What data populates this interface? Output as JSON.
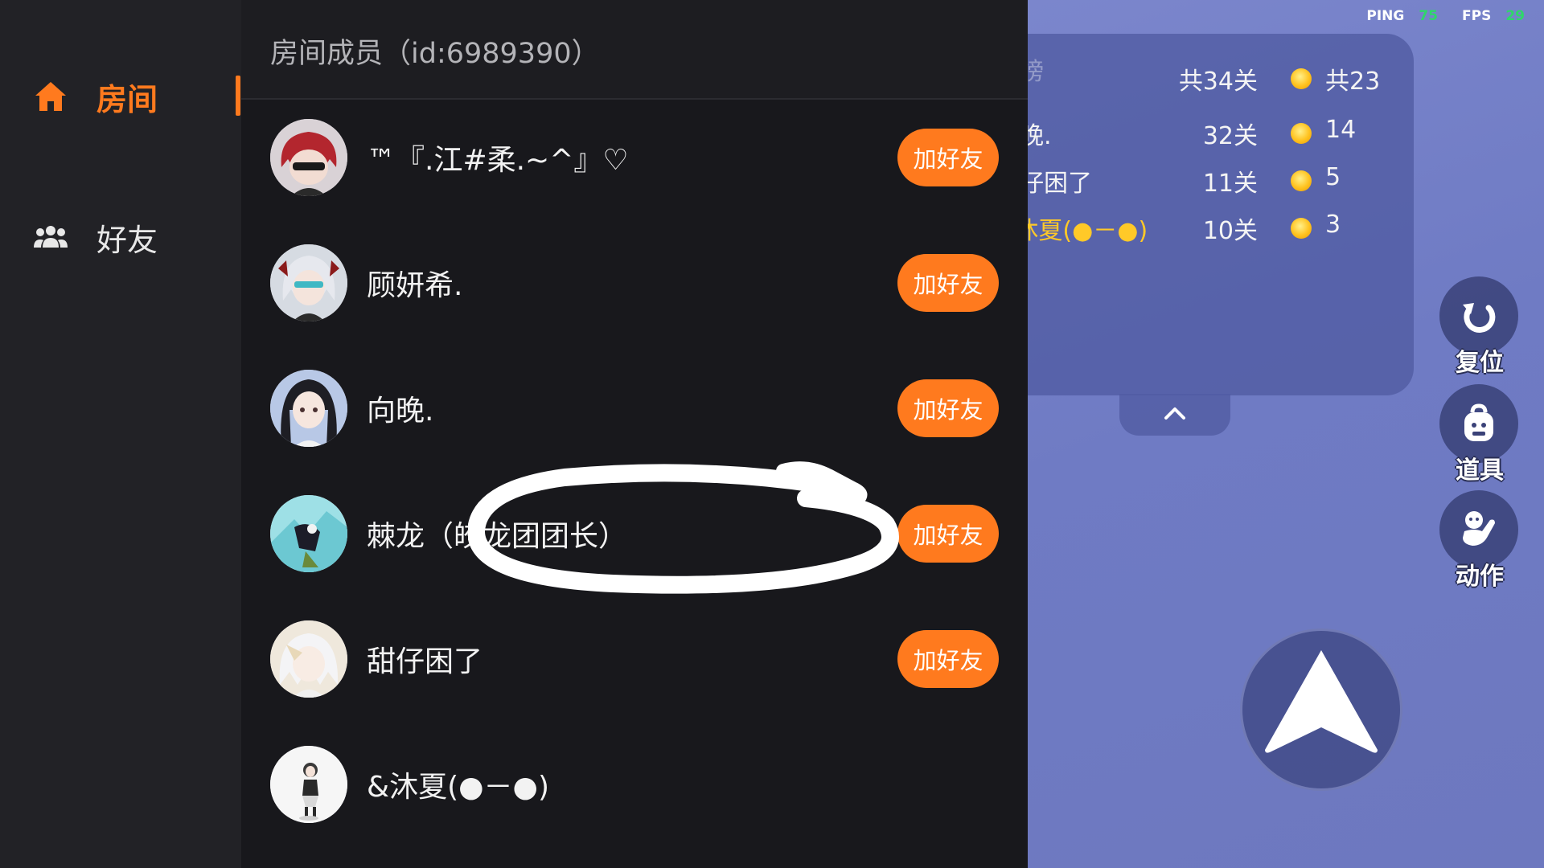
{
  "nav": {
    "items": [
      {
        "label": "房间",
        "icon": "home-icon",
        "active": true
      },
      {
        "label": "好友",
        "icon": "people-icon",
        "active": false
      }
    ]
  },
  "panel": {
    "title": "房间成员（id:6989390）",
    "members": [
      {
        "name": "™『.江#柔.~^』♡",
        "button": "加好友"
      },
      {
        "name": "顾妍希.",
        "button": "加好友"
      },
      {
        "name": "向晚.",
        "button": "加好友"
      },
      {
        "name": "棘龙（皎龙团团长）",
        "button": "加好友"
      },
      {
        "name": "甜仔困了",
        "button": "加好友"
      },
      {
        "name": "&沐夏(●－●)"
      }
    ]
  },
  "hud": {
    "ping_label": "PING",
    "ping_value": "75",
    "fps_label": "FPS",
    "fps_value": "29"
  },
  "leaderboard": {
    "title_partial": "排行榜",
    "rows": [
      {
        "name": "",
        "level": "共34关",
        "coins": "共23"
      },
      {
        "name": "向晚.",
        "level": "32关",
        "coins": "14"
      },
      {
        "name": "甜仔困了",
        "level": "11关",
        "coins": "5"
      },
      {
        "name": "&沐夏(●－●)",
        "level": "10关",
        "coins": "3"
      }
    ]
  },
  "actions": {
    "reset": "复位",
    "items": "道具",
    "emote": "动作"
  },
  "colors": {
    "accent": "#ff7a1e",
    "highlight_name": "#ffc928",
    "hud_value": "#2fd66a"
  }
}
